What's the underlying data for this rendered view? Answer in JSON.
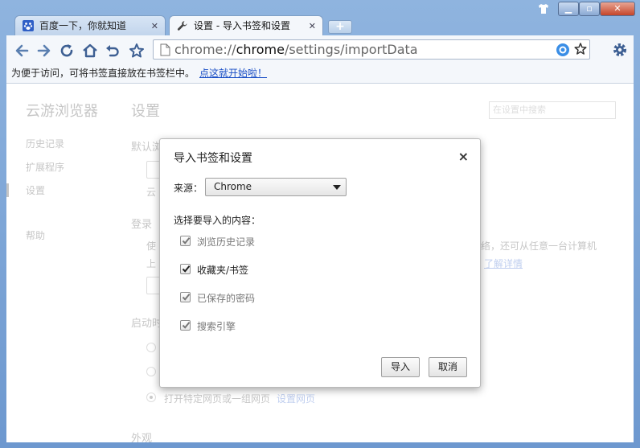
{
  "tabs": [
    {
      "label": "百度一下，你就知道",
      "icon": "paw-icon",
      "active": false
    },
    {
      "label": "设置 - 导入书签和设置",
      "icon": "wrench-icon",
      "active": true
    }
  ],
  "toolbar": {
    "url_scheme": "chrome://",
    "url_host": "chrome",
    "url_path": "/settings/importData"
  },
  "bookmark_bar": {
    "message": "为便于访问，可将书签直接放在书签栏中。",
    "link": "点这就开始啦！"
  },
  "settings": {
    "brand": "云游浏览器",
    "sidebar": [
      "历史记录",
      "扩展程序",
      "设置",
      "帮助"
    ],
    "page_title": "设置",
    "search_placeholder": "在设置中搜索",
    "sections": {
      "default_partial": "默认浏",
      "login": "登录",
      "startup_partial": "启动时",
      "appearance": "外观"
    },
    "fragments": {
      "cloud_partial": "云",
      "use_partial": "使",
      "up_partial": "上",
      "login_tail": "络，还可从任意一台计算机",
      "learn_more": "了解详情",
      "open_pages": "打开特定网页或一组网页",
      "set_pages": "设置网页"
    }
  },
  "dialog": {
    "title": "导入书签和设置",
    "source_label": "来源：",
    "source_value": "Chrome",
    "select_label": "选择要导入的内容：",
    "items": [
      {
        "label": "浏览历史记录",
        "checked": true,
        "enabled": false
      },
      {
        "label": "收藏夹/书签",
        "checked": true,
        "enabled": true
      },
      {
        "label": "已保存的密码",
        "checked": true,
        "enabled": false
      },
      {
        "label": "搜索引擎",
        "checked": true,
        "enabled": false
      }
    ],
    "import_button": "导入",
    "cancel_button": "取消"
  }
}
